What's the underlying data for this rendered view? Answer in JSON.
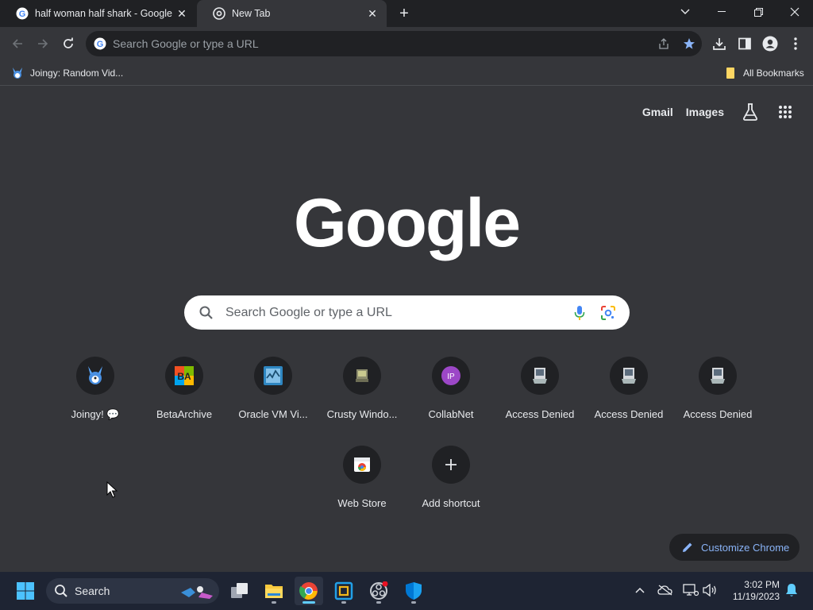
{
  "tabs": [
    {
      "title": "half woman half shark - Google",
      "active": false
    },
    {
      "title": "New Tab",
      "active": true
    }
  ],
  "omnibox": {
    "placeholder": "Search Google or type a URL"
  },
  "bookmarks": {
    "items": [
      {
        "label": "Joingy: Random Vid..."
      }
    ],
    "all_bookmarks": "All Bookmarks"
  },
  "ntp": {
    "top_links": [
      "Gmail",
      "Images"
    ],
    "logo": "Google",
    "search_placeholder": "Search Google or type a URL",
    "shortcuts": [
      {
        "label": "Joingy! 💬",
        "icon": "joingy-icon"
      },
      {
        "label": "BetaArchive",
        "icon": "betaarchive-icon"
      },
      {
        "label": "Oracle VM Vi...",
        "icon": "oracle-vm-icon"
      },
      {
        "label": "Crusty Windo...",
        "icon": "crusty-windows-icon"
      },
      {
        "label": "CollabNet",
        "icon": "collabnet-icon",
        "initials": "IP"
      },
      {
        "label": "Access Denied",
        "icon": "access-denied-icon"
      },
      {
        "label": "Access Denied",
        "icon": "access-denied-icon"
      },
      {
        "label": "Access Denied",
        "icon": "access-denied-icon"
      },
      {
        "label": "Web Store",
        "icon": "web-store-icon"
      },
      {
        "label": "Add shortcut",
        "icon": "plus-icon"
      }
    ],
    "customize_label": "Customize Chrome"
  },
  "taskbar": {
    "search_label": "Search",
    "time": "3:02 PM",
    "date": "11/19/2023"
  },
  "colors": {
    "background": "#35363a",
    "tabstrip": "#202124",
    "accent": "#8ab4f8",
    "taskbar": "#1e2433"
  }
}
